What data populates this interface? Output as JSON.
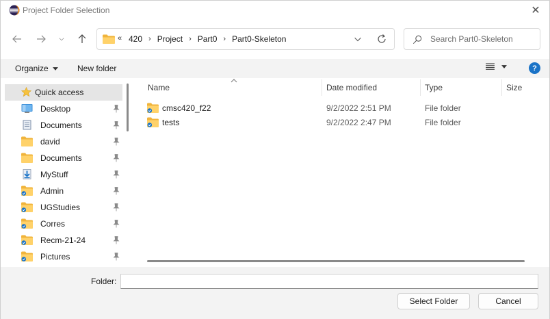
{
  "window": {
    "title": "Project Folder Selection",
    "close_glyph": "✕",
    "accent": "#1a73c7"
  },
  "address": {
    "overflow": "«",
    "crumbs": [
      "420",
      "Project",
      "Part0",
      "Part0-Skeleton"
    ],
    "separator": "›"
  },
  "search": {
    "placeholder": "Search Part0-Skeleton"
  },
  "toolbar": {
    "organize_label": "Organize",
    "new_folder_label": "New folder",
    "help_glyph": "?"
  },
  "sidebar": {
    "items": [
      {
        "label": "Quick access",
        "icon": "star-icon",
        "selected": true
      },
      {
        "label": "Desktop",
        "icon": "desktop-icon"
      },
      {
        "label": "Documents",
        "icon": "documents-icon"
      },
      {
        "label": "david",
        "icon": "folder-icon"
      },
      {
        "label": "Documents",
        "icon": "folder-icon"
      },
      {
        "label": "MyStuff",
        "icon": "download-folder-icon"
      },
      {
        "label": "Admin",
        "icon": "folder-synced-icon"
      },
      {
        "label": "UGStudies",
        "icon": "folder-synced-icon"
      },
      {
        "label": "Corres",
        "icon": "folder-synced-icon"
      },
      {
        "label": "Recm-21-24",
        "icon": "folder-synced-icon"
      },
      {
        "label": "Pictures",
        "icon": "folder-synced-icon"
      }
    ]
  },
  "files": {
    "columns": {
      "name": "Name",
      "date": "Date modified",
      "type": "Type",
      "size": "Size"
    },
    "rows": [
      {
        "name": "cmsc420_f22",
        "date": "9/2/2022 2:51 PM",
        "type": "File folder"
      },
      {
        "name": "tests",
        "date": "9/2/2022 2:47 PM",
        "type": "File folder"
      }
    ]
  },
  "footer": {
    "folder_label": "Folder:",
    "folder_value": "",
    "select_label": "Select Folder",
    "cancel_label": "Cancel"
  }
}
